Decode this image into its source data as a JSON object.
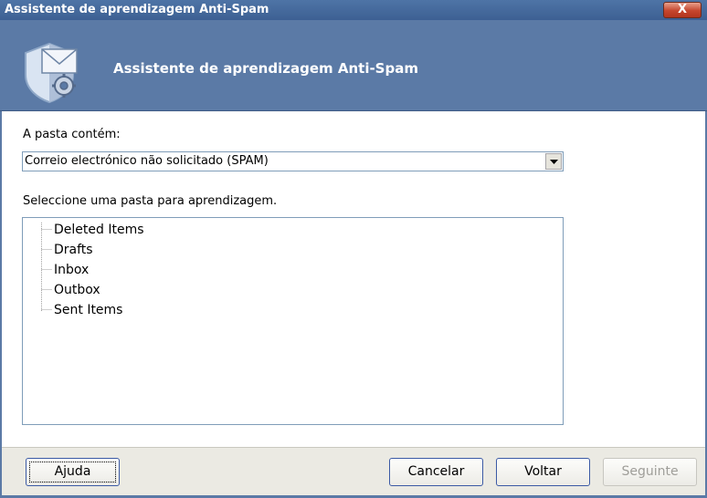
{
  "window": {
    "title": "Assistente de aprendizagem Anti-Spam",
    "close_symbol": "X"
  },
  "header": {
    "title": "Assistente de aprendizagem Anti-Spam",
    "icon": "shield-mail-gear-icon"
  },
  "folder_type": {
    "label": "A pasta contém:",
    "selected": "Correio electrónico não solicitado (SPAM)"
  },
  "folder_select": {
    "label": "Seleccione uma pasta para aprendizagem.",
    "items": [
      "Deleted Items",
      "Drafts",
      "Inbox",
      "Outbox",
      "Sent Items"
    ]
  },
  "buttons": {
    "help": "Ajuda",
    "cancel": "Cancelar",
    "back": "Voltar",
    "next": "Seguinte"
  },
  "colors": {
    "header_bg": "#5b7aa6",
    "titlebar_bg": "#4e74a6",
    "close_btn": "#c5452d",
    "footer_bg": "#ebeae3"
  }
}
